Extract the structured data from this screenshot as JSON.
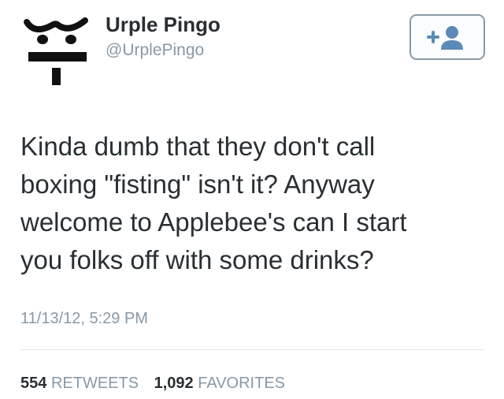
{
  "user": {
    "name": "Urple Pingo",
    "handle": "@UrplePingo"
  },
  "tweet": {
    "lines": [
      "Kinda dumb that they don't call",
      "boxing \"fisting\" isn't it? Anyway",
      "welcome to Applebee's can I start",
      "you folks off with some drinks?"
    ],
    "timestamp": "11/13/12, 5:29 PM"
  },
  "stats": {
    "retweets_count": "554",
    "retweets_label": "RETWEETS",
    "favorites_count": "1,092",
    "favorites_label": "FAVORITES"
  },
  "follow_button": {
    "icon": "add-user-icon"
  },
  "colors": {
    "text": "#292f33",
    "muted": "#8899a6",
    "divider": "#e1e8ed"
  }
}
